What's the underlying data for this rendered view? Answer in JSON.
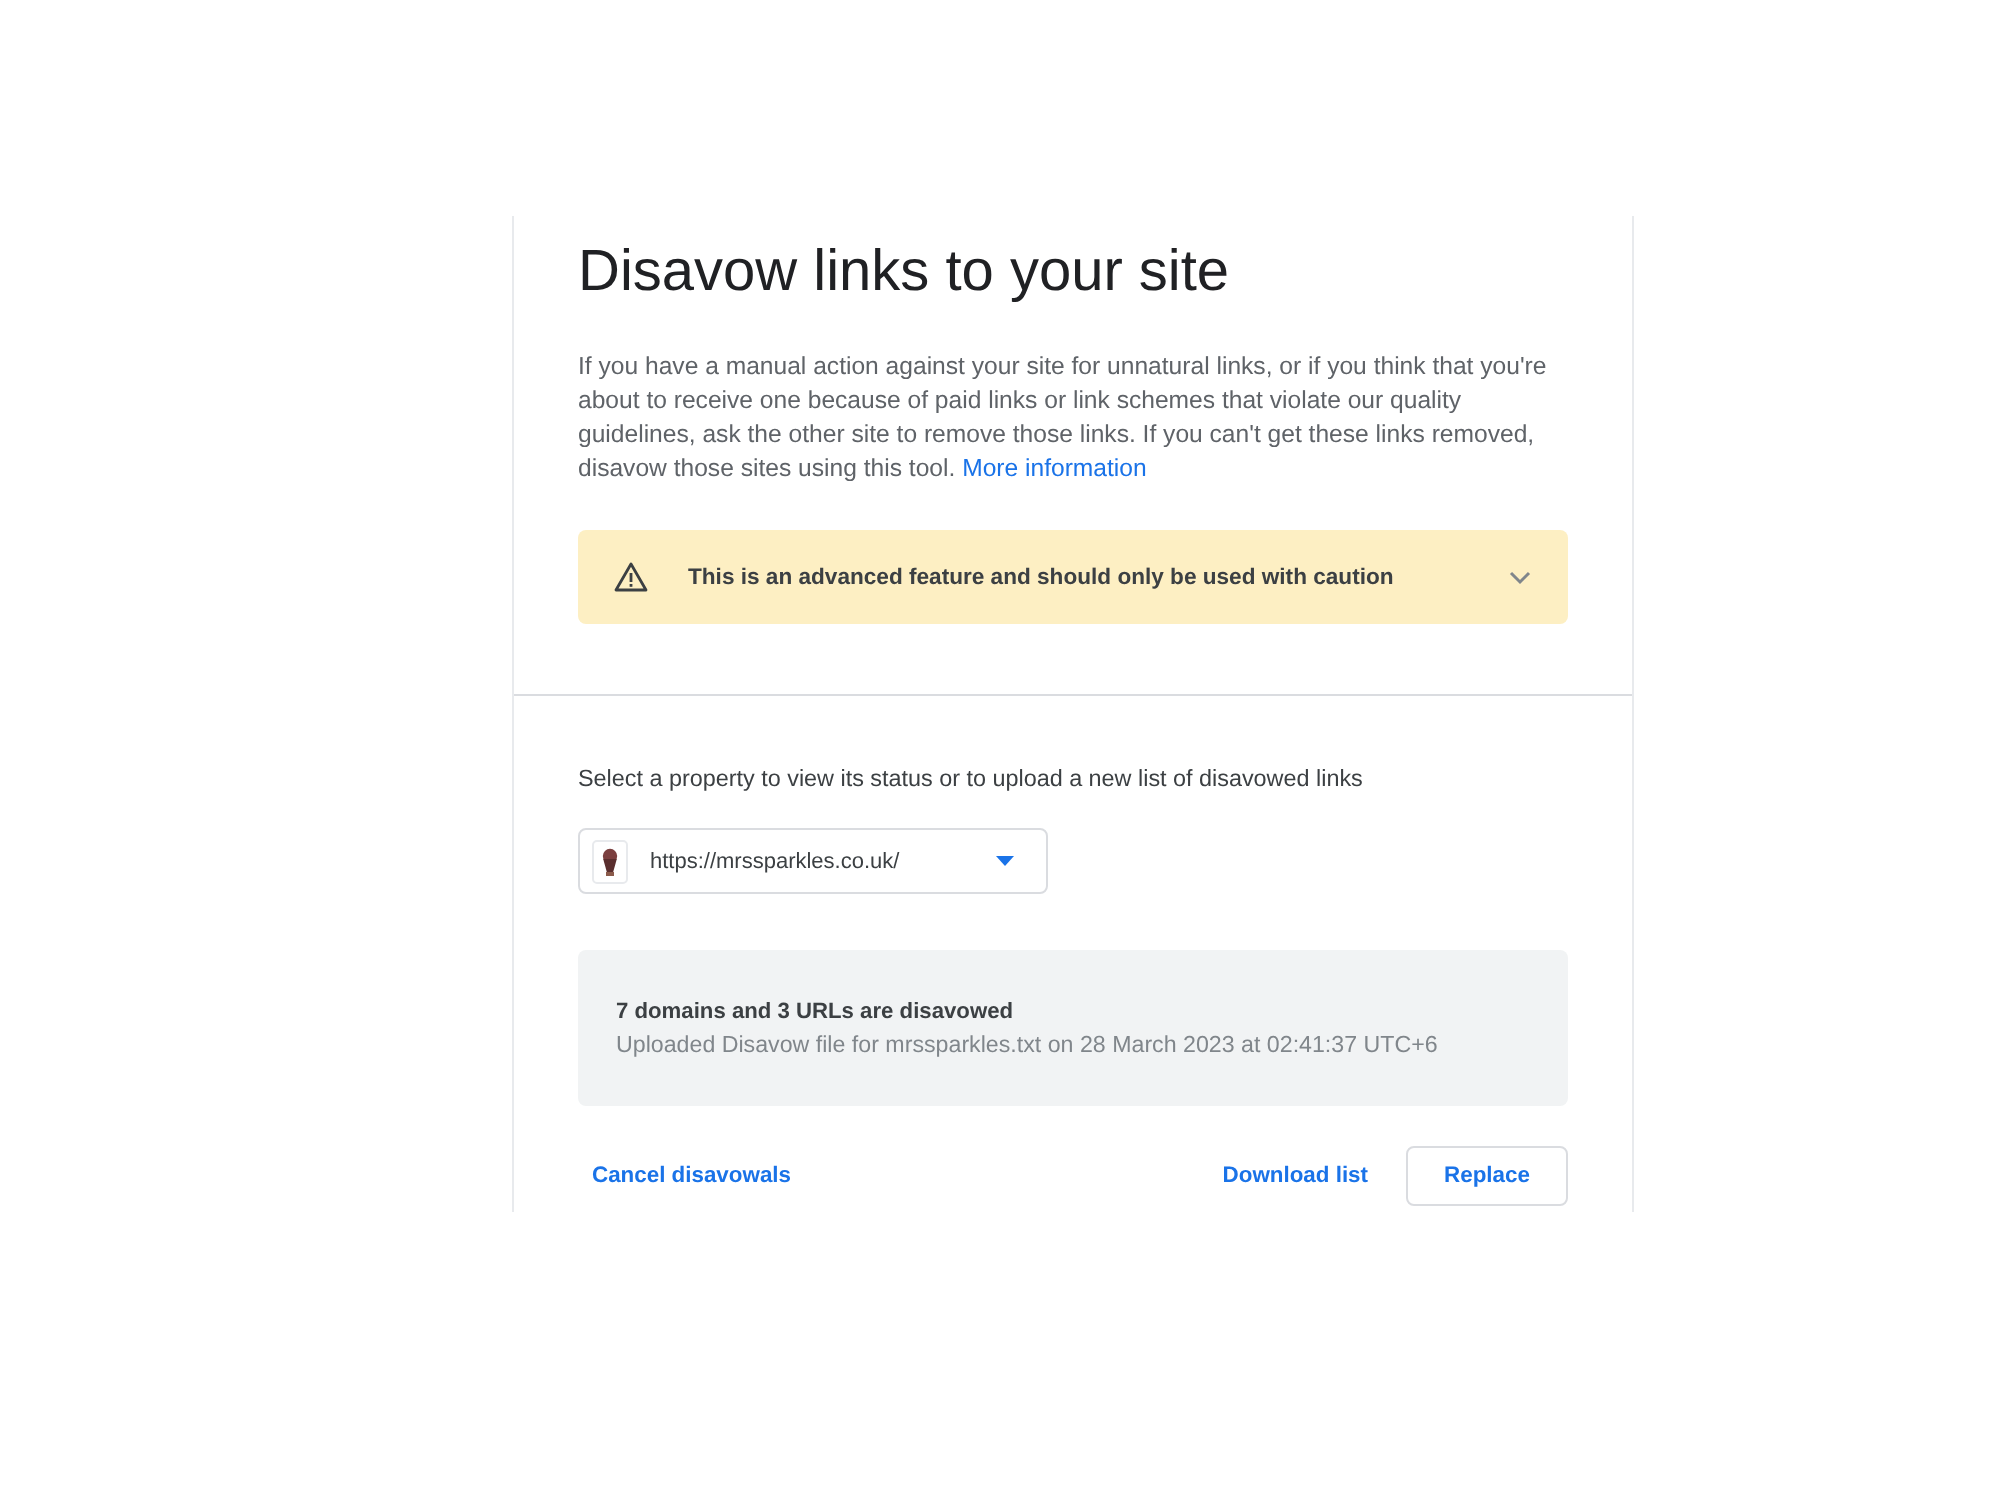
{
  "header": {
    "title": "Disavow links to your site",
    "description": "If you have a manual action against your site for unnatural links, or if you think that you're about to receive one because of paid links or link schemes that violate our quality guidelines, ask the other site to remove those links. If you can't get these links removed, disavow those sites using this tool.",
    "link": "More information"
  },
  "warning": {
    "text": "This is an advanced feature and should only be used with caution",
    "expanded": false
  },
  "property": {
    "prompt": "Select a property to view its status or to upload a new list of disavowed links",
    "selector": {
      "value": "https://mrssparkles.co.uk/"
    }
  },
  "status": {
    "heading": "7 domains and 3 URLs are disavowed",
    "detail": "Uploaded Disavow file for mrssparkles.txt on 28 March 2023 at 02:41:37 UTC+6"
  },
  "actions_left": [
    {
      "label": "Cancel disavowals",
      "kind": "text"
    }
  ],
  "actions_right": [
    {
      "label": "Download list",
      "kind": "text"
    },
    {
      "label": "Replace",
      "kind": "outlined"
    }
  ]
}
